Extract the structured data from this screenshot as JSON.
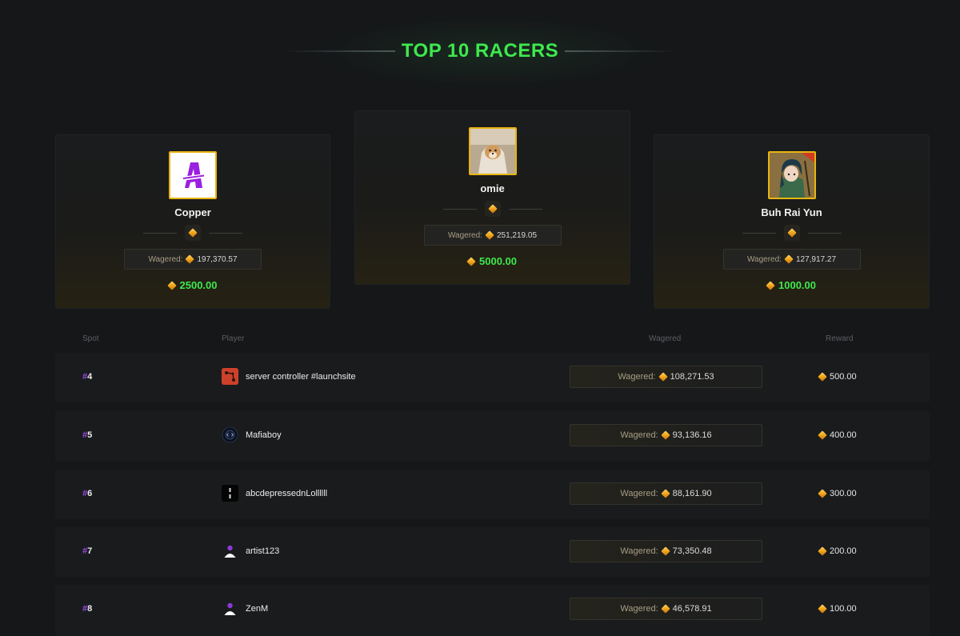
{
  "title": "TOP 10 RACERS",
  "podium": [
    {
      "place": 2,
      "name": "Copper",
      "wager_label": "Wagered:",
      "wagered": "197,370.57",
      "reward": "2500.00",
      "avatar_icon": "letter-a-logo-avatar"
    },
    {
      "place": 1,
      "name": "omie",
      "wager_label": "Wagered:",
      "wagered": "251,219.05",
      "reward": "5000.00",
      "avatar_icon": "dog-photo-avatar"
    },
    {
      "place": 3,
      "name": "Buh Rai Yun",
      "wager_label": "Wagered:",
      "wagered": "127,917.27",
      "reward": "1000.00",
      "avatar_icon": "anime-character-avatar"
    }
  ],
  "table": {
    "headers": {
      "spot": "Spot",
      "player": "Player",
      "wagered": "Wagered",
      "reward": "Reward"
    },
    "rows": [
      {
        "hash": "#",
        "spot": "4",
        "player": "server controller #launchsite",
        "wager_label": "Wagered:",
        "wagered": "108,271.53",
        "reward": "500.00",
        "avatar_icon": "rust-game-avatar"
      },
      {
        "hash": "#",
        "spot": "5",
        "player": "Mafiaboy",
        "wager_label": "Wagered:",
        "wagered": "93,136.16",
        "reward": "400.00",
        "avatar_icon": "code-badge-avatar"
      },
      {
        "hash": "#",
        "spot": "6",
        "player": "abcdepressednLollllll",
        "wager_label": "Wagered:",
        "wagered": "88,161.90",
        "reward": "300.00",
        "avatar_icon": "dark-avatar"
      },
      {
        "hash": "#",
        "spot": "7",
        "player": "artist123",
        "wager_label": "Wagered:",
        "wagered": "73,350.48",
        "reward": "200.00",
        "avatar_icon": "default-user-avatar"
      },
      {
        "hash": "#",
        "spot": "8",
        "player": "ZenM",
        "wager_label": "Wagered:",
        "wagered": "46,578.91",
        "reward": "100.00",
        "avatar_icon": "default-user-avatar"
      }
    ]
  },
  "colors": {
    "accent_green": "#3ee84d",
    "gold": "#e8b511",
    "purple_hash": "#9b4be8",
    "background": "#151719"
  }
}
